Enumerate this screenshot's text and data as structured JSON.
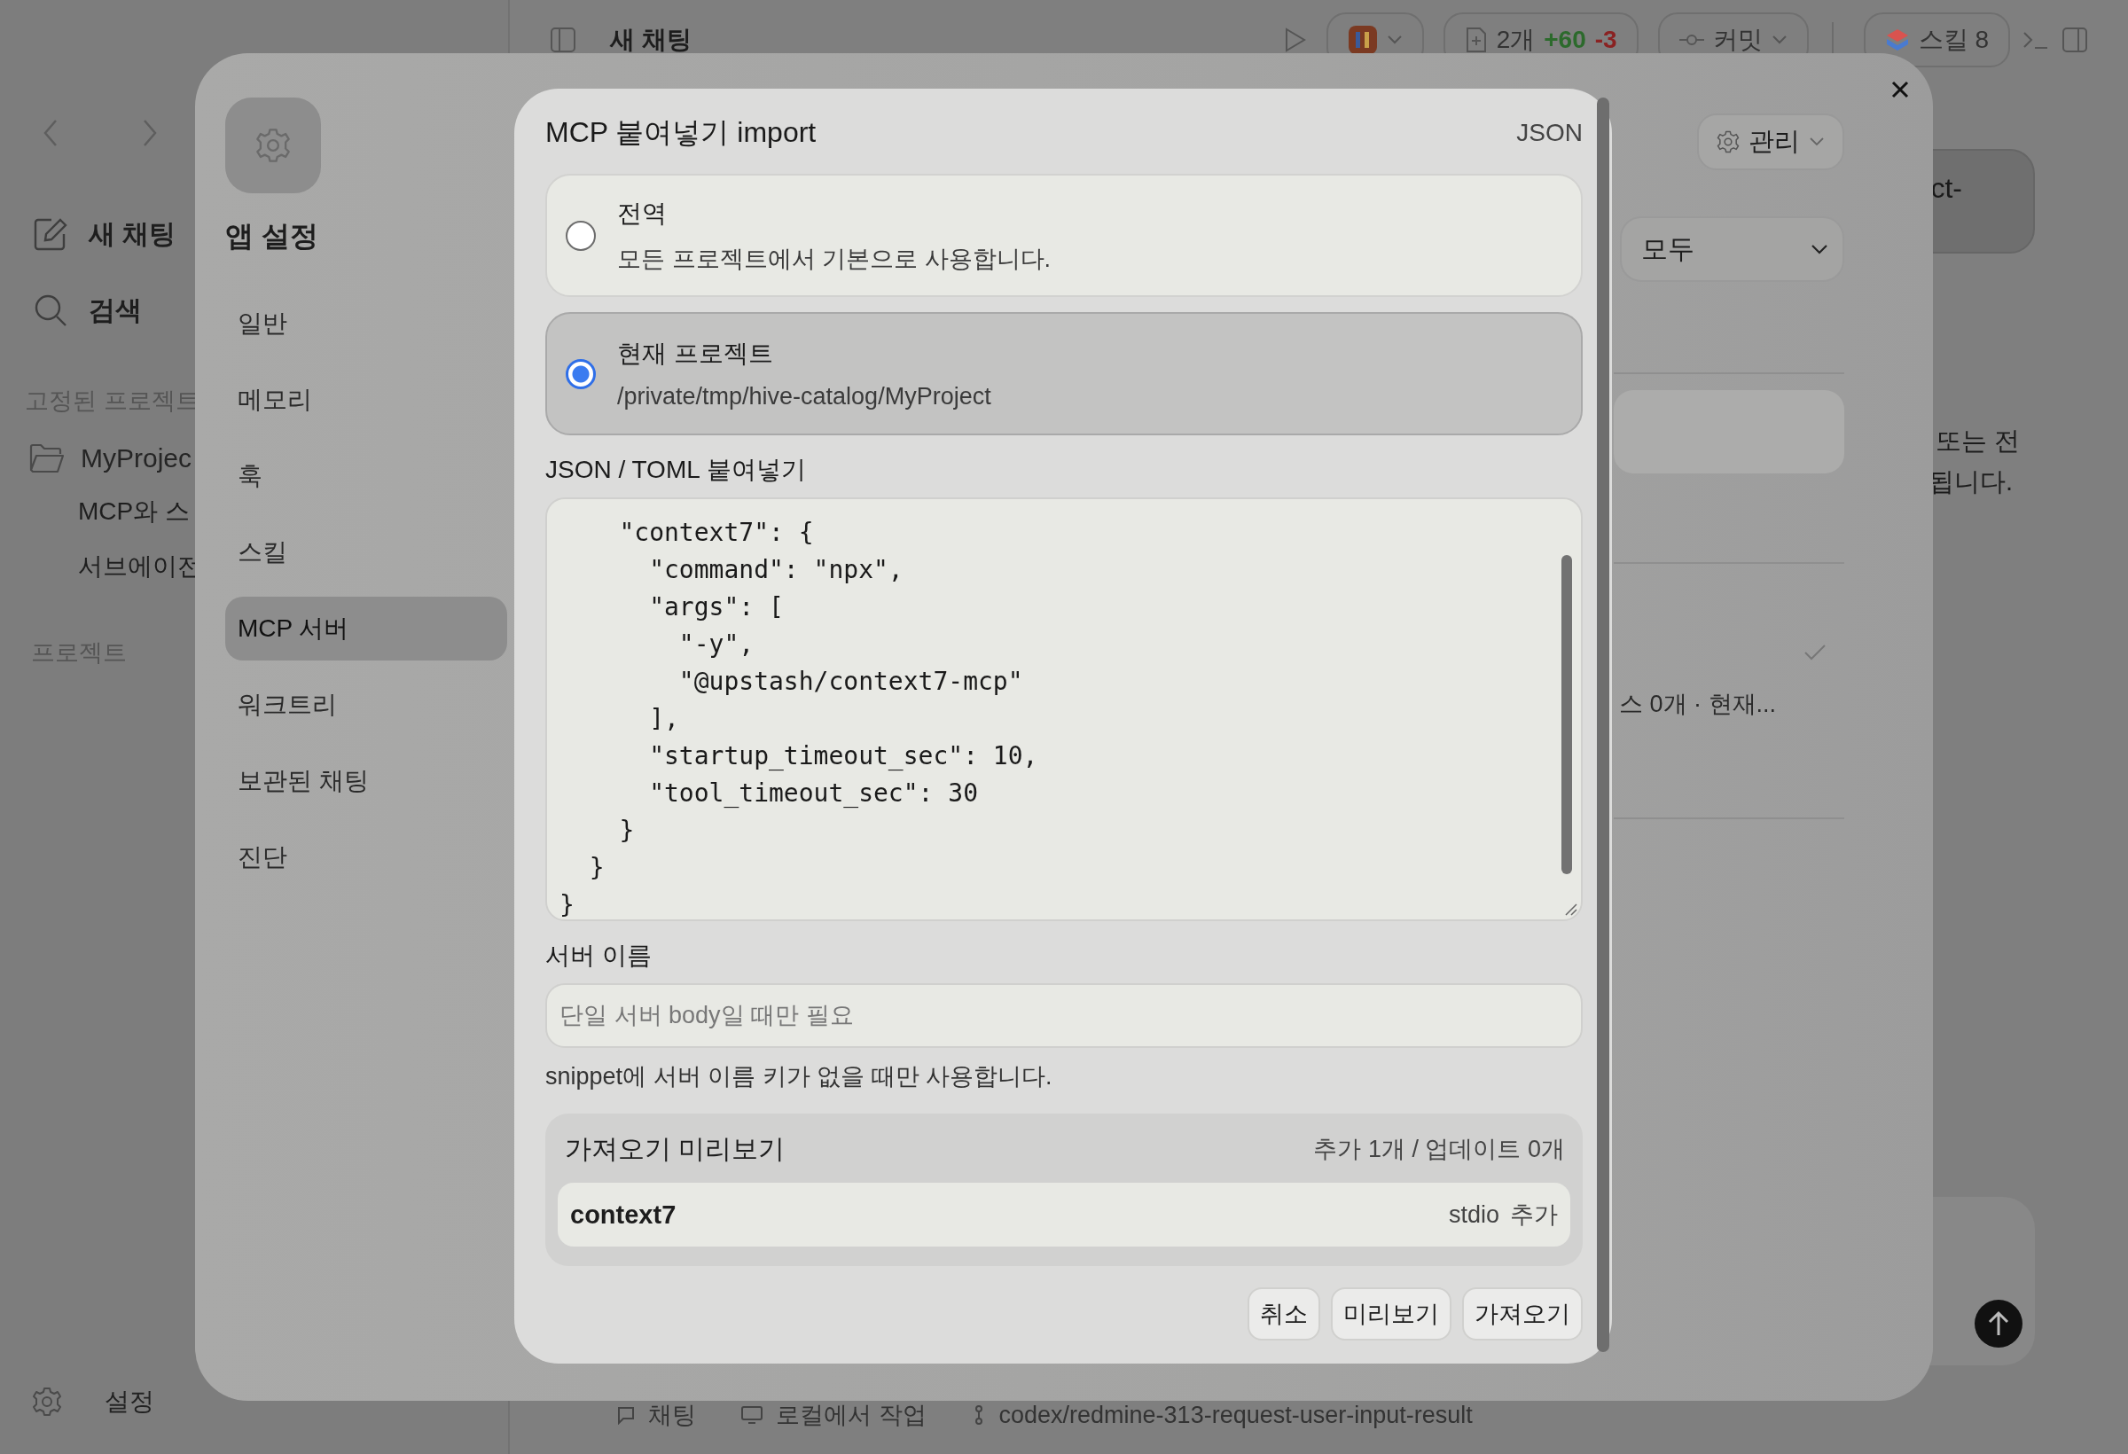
{
  "sidebar": {
    "actions": [
      {
        "label": "새 채팅"
      },
      {
        "label": "검색"
      }
    ],
    "pinned_heading": "고정된 프로젝트",
    "pinned_projects": [
      {
        "name": "MyProjec",
        "children": [
          {
            "title": "MCP와 스"
          },
          {
            "title": "서브에이전"
          }
        ]
      }
    ],
    "projects_heading": "프로젝트",
    "footer": "설정"
  },
  "toolbar": {
    "title": "새 채팅",
    "changes": {
      "count": "2개",
      "added": "+60",
      "removed": "-3"
    },
    "commit": "커밋",
    "skills": "스킬 8"
  },
  "bottom_bar": {
    "mode": "채팅",
    "location": "로컬에서 작업",
    "branch": "codex/redmine-313-request-user-input-result"
  },
  "background_content": {
    "snippet": "ct-",
    "note_lines": [
      "또는 전",
      "됩니다."
    ]
  },
  "settings": {
    "title": "앱 설정",
    "nav": [
      {
        "label": "일반",
        "selected": false
      },
      {
        "label": "메모리",
        "selected": false
      },
      {
        "label": "훅",
        "selected": false
      },
      {
        "label": "스킬",
        "selected": false
      },
      {
        "label": "MCP 서버",
        "selected": true
      },
      {
        "label": "워크트리",
        "selected": false
      },
      {
        "label": "보관된 채팅",
        "selected": false
      },
      {
        "label": "진단",
        "selected": false
      }
    ],
    "manage_button": "관리",
    "scope_select": "모두",
    "server_summary": "스 0개 · 현재..."
  },
  "dialog": {
    "title": "MCP 붙여넣기 import",
    "format": "JSON",
    "scopes": [
      {
        "label": "전역",
        "description": "모든 프로젝트에서 기본으로 사용합니다.",
        "selected": false
      },
      {
        "label": "현재 프로젝트",
        "description": "/private/tmp/hive-catalog/MyProject",
        "selected": true
      }
    ],
    "snippet_label": "JSON / TOML 붙여넣기",
    "snippet_lines": [
      "    \"context7\": {",
      "      \"command\": \"npx\",",
      "      \"args\": [",
      "        \"-y\",",
      "        \"@upstash/context7-mcp\"",
      "      ],",
      "      \"startup_timeout_sec\": 10,",
      "      \"tool_timeout_sec\": 30",
      "    }",
      "  }",
      "}"
    ],
    "server_name": {
      "label": "서버 이름",
      "placeholder": "단일 서버 body일 때만 필요",
      "help": "snippet에 서버 이름 키가 없을 때만 사용합니다."
    },
    "preview": {
      "title": "가져오기 미리보기",
      "summary": "추가 1개 / 업데이트 0개",
      "items": [
        {
          "name": "context7",
          "transport": "stdio",
          "action": "추가"
        }
      ]
    },
    "buttons": [
      "취소",
      "미리보기",
      "가져오기"
    ]
  }
}
